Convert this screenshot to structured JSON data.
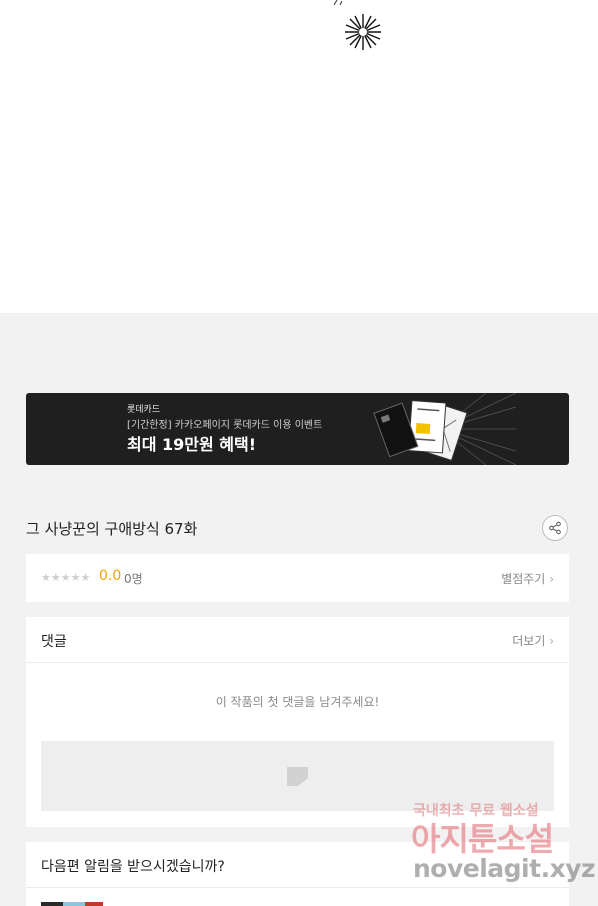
{
  "banner": {
    "brand": "롯데카드",
    "subtitle": "[기간한정] 카카오페이지 롯데카드 이용 이벤트",
    "headline": "최대 19만원 혜택!"
  },
  "episode": {
    "title": "그 사냥꾼의 구애방식 67화"
  },
  "rating": {
    "stars": "★★★★★",
    "score": "0.0",
    "count": "0명",
    "rate_link": "별점주기"
  },
  "comments": {
    "title": "댓글",
    "more": "더보기",
    "empty_message": "이 작품의 첫 댓글을 남겨주세요!"
  },
  "notify": {
    "title": "다음편 알림을 받으시겠습니까?"
  },
  "watermark": {
    "line1": "국내최초 무료 웹소설",
    "line2": "아지툰소설",
    "line3": "novelagit.xyz"
  },
  "icons": {
    "share": "share-icon",
    "chevron": "chevron-right-icon",
    "image_placeholder": "image-placeholder-icon"
  },
  "colors": {
    "score": "#f0a500",
    "banner_bg": "#1f1f1f"
  }
}
